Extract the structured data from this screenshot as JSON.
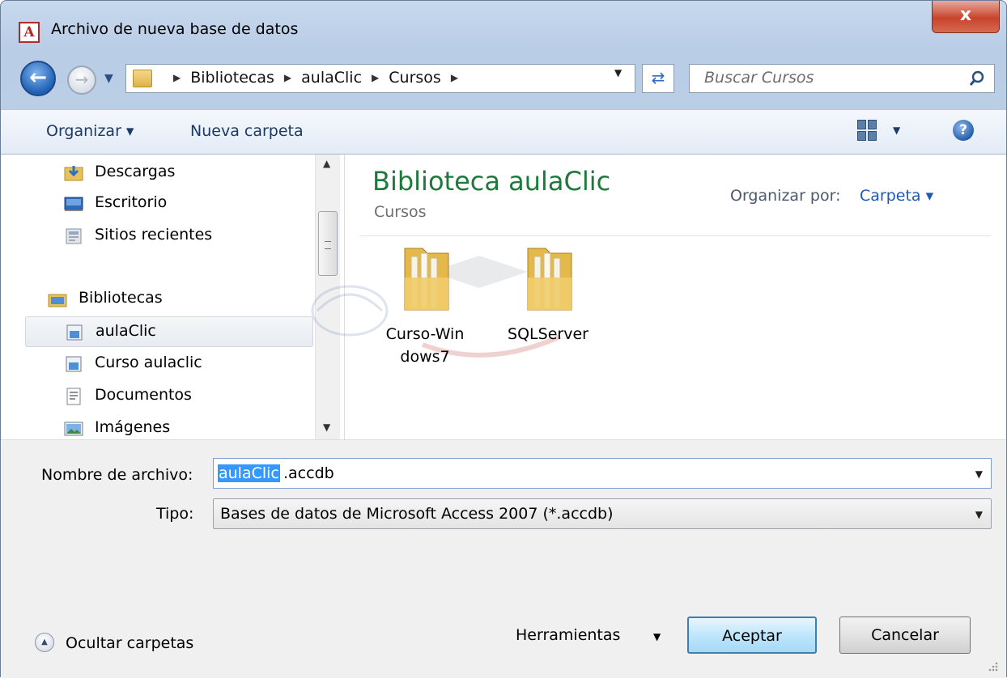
{
  "window": {
    "title": "Archivo de nueva base de datos",
    "app_icon": "A",
    "close_label": "x"
  },
  "nav": {
    "path": [
      "Bibliotecas",
      "aulaClic",
      "Cursos"
    ],
    "search_placeholder": "Buscar Cursos"
  },
  "toolbar": {
    "organize": "Organizar ▾",
    "new_folder": "Nueva carpeta",
    "help": "?"
  },
  "sidebar": {
    "items": [
      {
        "label": "Descargas",
        "icon": "downloads-folder-icon"
      },
      {
        "label": "Escritorio",
        "icon": "desktop-icon"
      },
      {
        "label": "Sitios recientes",
        "icon": "recent-places-icon"
      },
      {
        "label": "Bibliotecas",
        "icon": "libraries-icon"
      },
      {
        "label": "aulaClic",
        "icon": "library-icon",
        "selected": true
      },
      {
        "label": "Curso aulaclic",
        "icon": "library-icon"
      },
      {
        "label": "Documentos",
        "icon": "documents-icon"
      },
      {
        "label": "Imágenes",
        "icon": "pictures-icon"
      }
    ]
  },
  "content": {
    "title": "Biblioteca aulaClic",
    "subtitle": "Cursos",
    "arrange_label": "Organizar por:",
    "arrange_value": "Carpeta ▾",
    "folders": [
      {
        "line1": "Curso-Win",
        "line2": "dows7"
      },
      {
        "line1": "SQLServer",
        "line2": ""
      }
    ]
  },
  "form": {
    "filename_label": "Nombre de archivo:",
    "filename_selected": "aulaClic",
    "filename_rest": ".accdb",
    "type_label": "Tipo:",
    "type_value": "Bases de datos de Microsoft Access 2007 (*.accdb)"
  },
  "footer": {
    "hide_folders": "Ocultar carpetas",
    "tools": "Herramientas",
    "ok": "Aceptar",
    "cancel": "Cancelar"
  },
  "colors": {
    "accent_green": "#1d7a3c",
    "link_blue": "#1e5ab4",
    "selection": "#3399ff",
    "close_red": "#c8442c"
  }
}
